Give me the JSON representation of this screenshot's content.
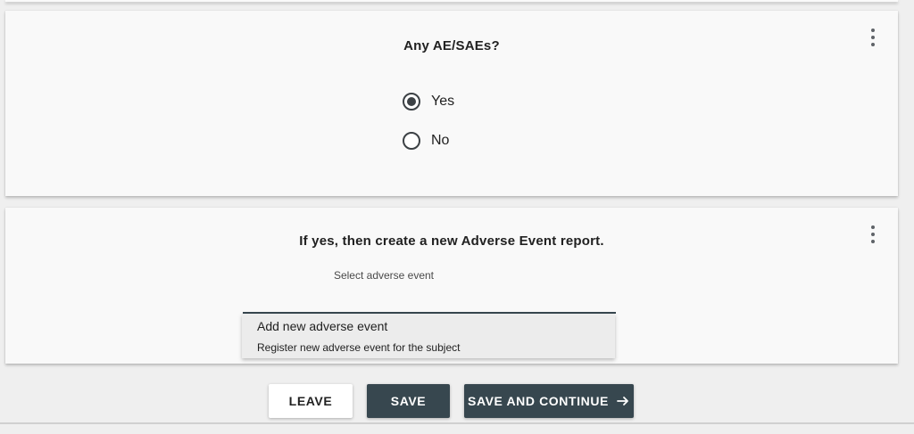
{
  "question_card": {
    "question": "Any AE/SAEs?",
    "options": [
      {
        "label": "Yes",
        "selected": true
      },
      {
        "label": "No",
        "selected": false
      }
    ],
    "menu_icon": "more-vertical-icon"
  },
  "adverse_event_card": {
    "title": "If yes, then create a new Adverse Event report.",
    "field_label": "Select adverse event",
    "menu_icon": "more-vertical-icon",
    "dropdown_option": {
      "title": "Add new adverse event",
      "subtitle": "Register new adverse event for the subject"
    }
  },
  "actions": {
    "leave_label": "LEAVE",
    "save_label": "SAVE",
    "save_continue_label": "SAVE AND CONTINUE",
    "save_continue_icon": "arrow-right-icon"
  },
  "colors": {
    "primary_dark": "#37474f",
    "card_background": "#f9f9f9",
    "page_background": "#efefef"
  }
}
